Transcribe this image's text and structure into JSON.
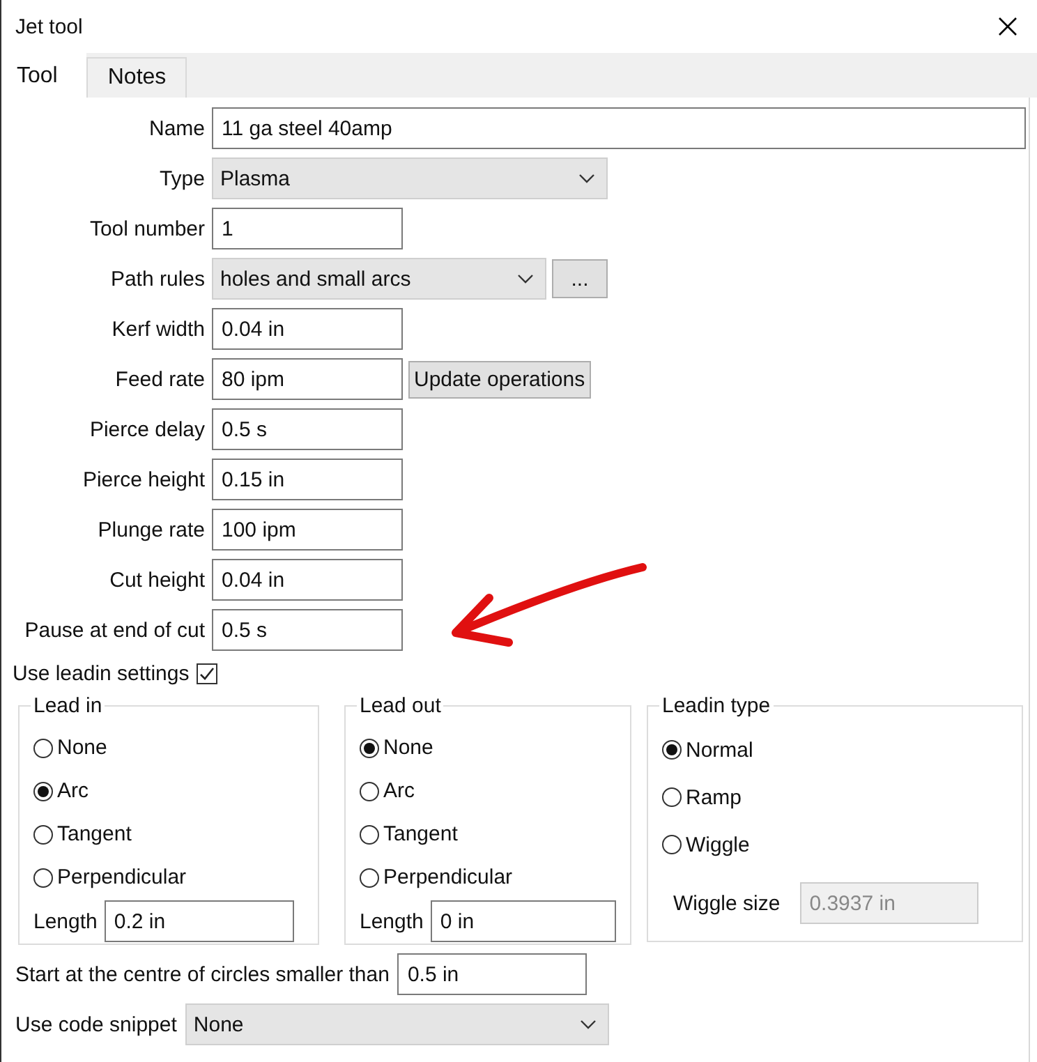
{
  "window": {
    "title": "Jet tool"
  },
  "tabs": [
    {
      "label": "Tool",
      "selected": true
    },
    {
      "label": "Notes",
      "selected": false
    }
  ],
  "fields": [
    {
      "label": "Name",
      "value": "11 ga steel 40amp",
      "kind": "wide-text"
    },
    {
      "label": "Type",
      "value": "Plasma",
      "kind": "select"
    },
    {
      "label": "Tool number",
      "value": "1",
      "kind": "text"
    },
    {
      "label": "Path rules",
      "value": "holes and small arcs",
      "kind": "short-select",
      "button": "..."
    },
    {
      "label": "Kerf width",
      "value": "0.04 in",
      "kind": "text"
    },
    {
      "label": "Feed rate",
      "value": "80 ipm",
      "kind": "text",
      "button": "Update operations"
    },
    {
      "label": "Pierce delay",
      "value": "0.5 s",
      "kind": "text"
    },
    {
      "label": "Pierce height",
      "value": "0.15 in",
      "kind": "text"
    },
    {
      "label": "Plunge rate",
      "value": "100 ipm",
      "kind": "text"
    },
    {
      "label": "Cut height",
      "value": "0.04 in",
      "kind": "text"
    },
    {
      "label": "Pause at end of cut",
      "value": "0.5 s",
      "kind": "text"
    }
  ],
  "use_leadin": {
    "label": "Use leadin settings",
    "checked": true
  },
  "groups": [
    {
      "title": "Lead in",
      "options": [
        {
          "label": "None",
          "selected": false
        },
        {
          "label": "Arc",
          "selected": true
        },
        {
          "label": "Tangent",
          "selected": false
        },
        {
          "label": "Perpendicular",
          "selected": false
        }
      ],
      "length": {
        "label": "Length",
        "value": "0.2 in"
      }
    },
    {
      "title": "Lead out",
      "options": [
        {
          "label": "None",
          "selected": true
        },
        {
          "label": "Arc",
          "selected": false
        },
        {
          "label": "Tangent",
          "selected": false
        },
        {
          "label": "Perpendicular",
          "selected": false
        }
      ],
      "length": {
        "label": "Length",
        "value": "0 in"
      }
    },
    {
      "title": "Leadin type",
      "options": [
        {
          "label": "Normal",
          "selected": true
        },
        {
          "label": "Ramp",
          "selected": false
        },
        {
          "label": "Wiggle",
          "selected": false
        }
      ],
      "wiggle_size": {
        "label": "Wiggle size",
        "value": "0.3937 in",
        "disabled": true
      }
    }
  ],
  "centre_start": {
    "label": "Start at the centre of circles smaller than",
    "value": "0.5 in"
  },
  "code_snippet": {
    "label": "Use code snippet",
    "value": "None"
  }
}
